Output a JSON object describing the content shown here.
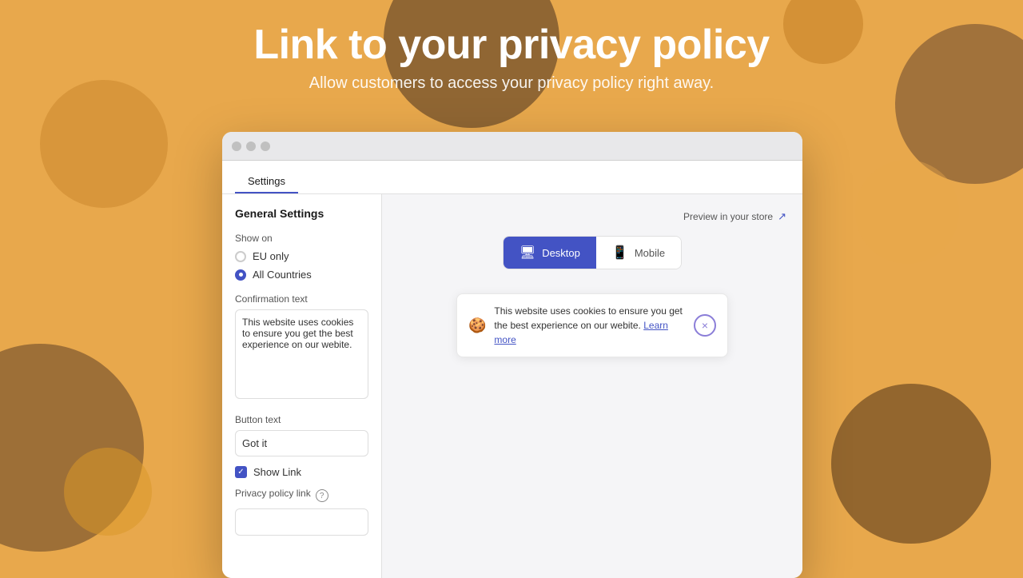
{
  "background": {
    "color": "#E8A84C"
  },
  "header": {
    "title": "Link to your privacy policy",
    "subtitle": "Allow customers to access your privacy policy right away."
  },
  "window": {
    "tabs": [
      {
        "label": "Settings",
        "active": true
      }
    ]
  },
  "settings": {
    "title": "General Settings",
    "show_on_label": "Show on",
    "radio_options": [
      {
        "label": "EU only",
        "selected": false
      },
      {
        "label": "All Countries",
        "selected": true
      }
    ],
    "confirmation_text_label": "Confirmation text",
    "confirmation_text_value": "This website uses cookies to ensure you get the best experience on our webite.",
    "button_text_label": "Button text",
    "button_text_value": "Got it",
    "show_link_label": "Show Link",
    "show_link_checked": true,
    "privacy_policy_link_label": "Privacy policy link",
    "privacy_policy_link_placeholder": ""
  },
  "preview": {
    "label": "Preview in your store",
    "link_icon": "↗",
    "toggle": {
      "desktop_label": "Desktop",
      "mobile_label": "Mobile",
      "active": "desktop"
    },
    "cookie_banner": {
      "icon": "🍪",
      "text": "This website uses cookies to ensure you get the best experience on our webite.",
      "learn_more": "Learn more",
      "close_icon": "×"
    }
  }
}
